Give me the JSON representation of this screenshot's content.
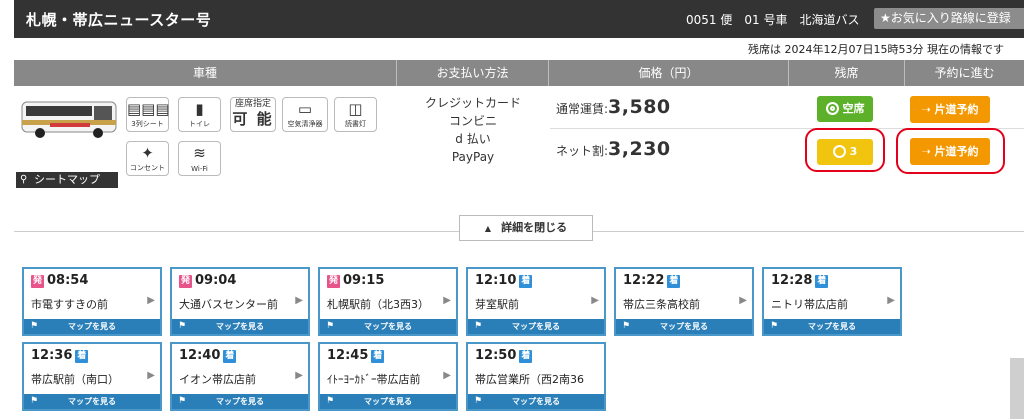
{
  "header": {
    "route_title": "札幌・帯広ニュースター号",
    "bus_meta": "0051 便　01 号車　北海道バス",
    "favorite_button": "★お気に入り路線に登録"
  },
  "seat_status_text": "残席は 2024年12月07日15時53分 現在の情報です",
  "table_headers": [
    "車種",
    "お支払い方法",
    "価格（円）",
    "残席",
    "予約に進む"
  ],
  "features": [
    {
      "icon": "three-row-seat-icon",
      "label": "3列シート"
    },
    {
      "icon": "toilet-icon",
      "label": "トイレ"
    },
    {
      "icon": "seat-reservation-icon",
      "label_top": "座席指定",
      "label_main": "可 能"
    },
    {
      "icon": "air-purifier-icon",
      "label": "空気清浄器"
    },
    {
      "icon": "reading-light-icon",
      "label": "読書灯"
    },
    {
      "icon": "outlet-icon",
      "label": "コンセント"
    },
    {
      "icon": "wifi-icon",
      "label": "Wi-Fi"
    }
  ],
  "seat_map_button": "シートマップ",
  "payment_methods": [
    "クレジットカード",
    "コンビニ",
    "d 払い",
    "PayPay"
  ],
  "fares": [
    {
      "label": "通常運賃:",
      "price": "3,580",
      "availability": "空席",
      "book_label": "片道予約"
    },
    {
      "label": "ネット割:",
      "price": "3,230",
      "availability": "3",
      "book_label": "片道予約"
    }
  ],
  "collapse_button": "詳細を閉じる",
  "stops_map_label": "マップを見る",
  "stops": [
    {
      "tag": "発",
      "kind": "dep",
      "time": "08:54",
      "name": "市電すすきの前"
    },
    {
      "tag": "発",
      "kind": "dep",
      "time": "09:04",
      "name": "大通バスセンター前"
    },
    {
      "tag": "発",
      "kind": "dep",
      "time": "09:15",
      "name": "札幌駅前（北3西3）"
    },
    {
      "tag": "着",
      "kind": "arr",
      "time": "12:10",
      "name": "芽室駅前"
    },
    {
      "tag": "着",
      "kind": "arr",
      "time": "12:22",
      "name": "帯広三条高校前"
    },
    {
      "tag": "着",
      "kind": "arr",
      "time": "12:28",
      "name": "ニトリ帯広店前"
    },
    {
      "tag": "着",
      "kind": "arr",
      "time": "12:36",
      "name": "帯広駅前（南口）"
    },
    {
      "tag": "着",
      "kind": "arr",
      "time": "12:40",
      "name": "イオン帯広店前"
    },
    {
      "tag": "着",
      "kind": "arr",
      "time": "12:45",
      "name": "ｲﾄｰﾖｰｶﾄﾞｰ帯広店前"
    },
    {
      "tag": "着",
      "kind": "arr",
      "time": "12:50",
      "name": "帯広営業所（西2南36"
    }
  ],
  "colors": {
    "header_bg": "#333333",
    "table_head_bg": "#888888",
    "vacant_green": "#5db12a",
    "few_yellow": "#f1c40f",
    "book_orange": "#f39800",
    "stop_border": "#4a97c9",
    "map_bar": "#2a7fb8",
    "depart_pink": "#e8548a",
    "arrive_blue": "#2f8fd8",
    "highlight_red": "#e2001a"
  }
}
